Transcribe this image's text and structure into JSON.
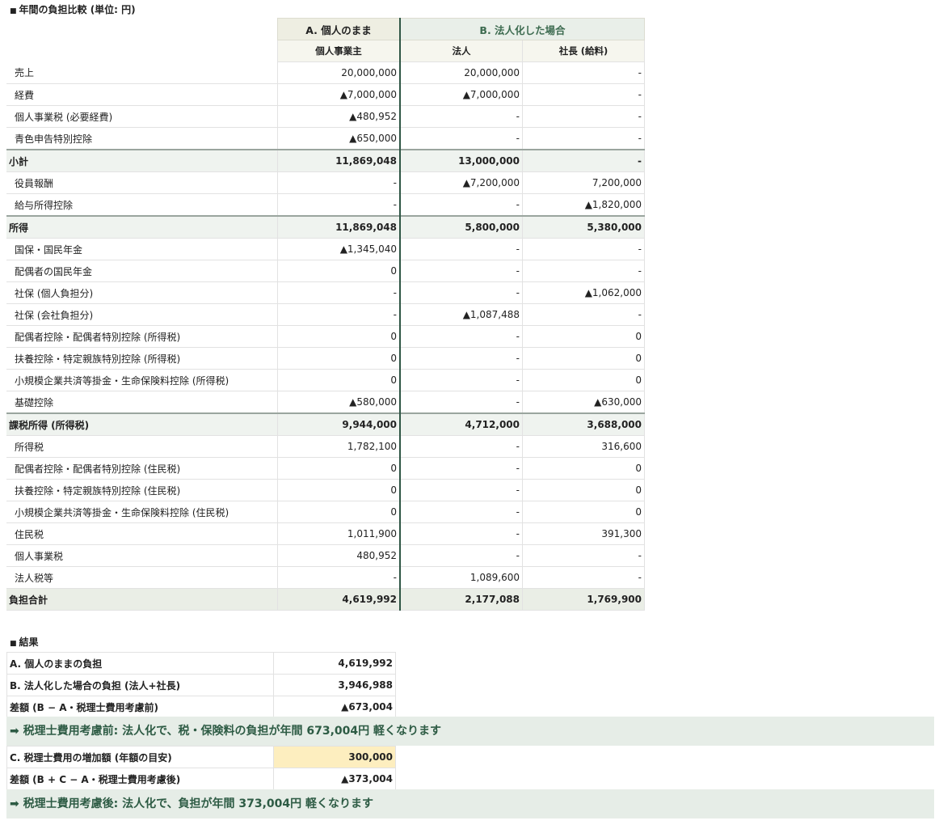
{
  "section1_title": "年間の負担比較 (単位: 円)",
  "header": {
    "groupA": "A. 個人のまま",
    "groupB": "B. 法人化した場合",
    "col1": "個人事業主",
    "col2": "法人",
    "col3": "社長 (給料)"
  },
  "rows": [
    {
      "type": "normal",
      "label": "売上",
      "c1": "20,000,000",
      "c2": "20,000,000",
      "c3": "-"
    },
    {
      "type": "normal",
      "label": "経費",
      "c1": "▲7,000,000",
      "c2": "▲7,000,000",
      "c3": "-"
    },
    {
      "type": "normal",
      "label": "個人事業税 (必要経費)",
      "c1": "▲480,952",
      "c2": "-",
      "c3": "-"
    },
    {
      "type": "normal",
      "label": "青色申告特別控除",
      "c1": "▲650,000",
      "c2": "-",
      "c3": "-"
    },
    {
      "type": "sub",
      "label": "小計",
      "c1": "11,869,048",
      "c2": "13,000,000",
      "c3": "-"
    },
    {
      "type": "normal",
      "label": "役員報酬",
      "c1": "-",
      "c2": "▲7,200,000",
      "c3": "7,200,000"
    },
    {
      "type": "normal",
      "label": "給与所得控除",
      "c1": "-",
      "c2": "-",
      "c3": "▲1,820,000"
    },
    {
      "type": "sub",
      "label": "所得",
      "c1": "11,869,048",
      "c2": "5,800,000",
      "c3": "5,380,000"
    },
    {
      "type": "normal",
      "label": "国保・国民年金",
      "c1": "▲1,345,040",
      "c2": "-",
      "c3": "-"
    },
    {
      "type": "normal",
      "label": "配偶者の国民年金",
      "c1": "0",
      "c2": "-",
      "c3": "-"
    },
    {
      "type": "normal",
      "label": "社保 (個人負担分)",
      "c1": "-",
      "c2": "-",
      "c3": "▲1,062,000"
    },
    {
      "type": "normal",
      "label": "社保 (会社負担分)",
      "c1": "-",
      "c2": "▲1,087,488",
      "c3": "-"
    },
    {
      "type": "normal",
      "label": "配偶者控除・配偶者特別控除 (所得税)",
      "c1": "0",
      "c2": "-",
      "c3": "0"
    },
    {
      "type": "normal",
      "label": "扶養控除・特定親族特別控除 (所得税)",
      "c1": "0",
      "c2": "-",
      "c3": "0"
    },
    {
      "type": "normal",
      "label": "小規模企業共済等掛金・生命保険料控除 (所得税)",
      "c1": "0",
      "c2": "-",
      "c3": "0"
    },
    {
      "type": "normal",
      "label": "基礎控除",
      "c1": "▲580,000",
      "c2": "-",
      "c3": "▲630,000"
    },
    {
      "type": "sub",
      "label": "課税所得 (所得税)",
      "c1": "9,944,000",
      "c2": "4,712,000",
      "c3": "3,688,000"
    },
    {
      "type": "normal",
      "label": "所得税",
      "c1": "1,782,100",
      "c2": "-",
      "c3": "316,600"
    },
    {
      "type": "normal",
      "label": "配偶者控除・配偶者特別控除 (住民税)",
      "c1": "0",
      "c2": "-",
      "c3": "0"
    },
    {
      "type": "normal",
      "label": "扶養控除・特定親族特別控除 (住民税)",
      "c1": "0",
      "c2": "-",
      "c3": "0"
    },
    {
      "type": "normal",
      "label": "小規模企業共済等掛金・生命保険料控除 (住民税)",
      "c1": "0",
      "c2": "-",
      "c3": "0"
    },
    {
      "type": "normal",
      "label": "住民税",
      "c1": "1,011,900",
      "c2": "-",
      "c3": "391,300"
    },
    {
      "type": "normal",
      "label": "個人事業税",
      "c1": "480,952",
      "c2": "-",
      "c3": "-"
    },
    {
      "type": "normal",
      "label": "法人税等",
      "c1": "-",
      "c2": "1,089,600",
      "c3": "-"
    },
    {
      "type": "tot",
      "label": "負担合計",
      "c1": "4,619,992",
      "c2": "2,177,088",
      "c3": "1,769,900"
    }
  ],
  "section2_title": "結果",
  "result": {
    "a_label": "A. 個人のままの負担",
    "a_value": "4,619,992",
    "b_label": "B. 法人化した場合の負担 (法人+社長)",
    "b_value": "3,946,988",
    "diff1_label": "差額 (B − A・税理士費用考慮前)",
    "diff1_value": "▲673,004",
    "banner1": "➡ 税理士費用考慮前: 法人化で、税・保険料の負担が年間 673,004円 軽くなります",
    "c_label": "C. 税理士費用の増加額 (年額の目安)",
    "c_value": "300,000",
    "diff2_label": "差額 (B + C − A・税理士費用考慮後)",
    "diff2_value": "▲373,004",
    "banner2": "➡ 税理士費用考慮後: 法人化で、負担が年間 373,004円 軽くなります"
  }
}
